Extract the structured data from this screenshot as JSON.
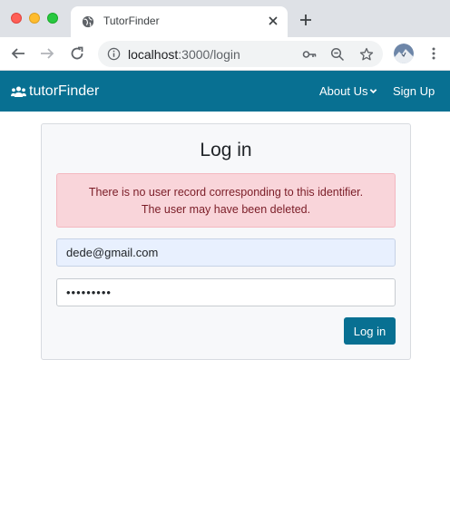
{
  "browser": {
    "tab_title": "TutorFinder",
    "url_host": "localhost",
    "url_rest": ":3000/login",
    "icons": [
      "globe-icon",
      "close-icon",
      "plus-icon",
      "back-icon",
      "forward-icon",
      "reload-icon",
      "info-icon",
      "key-icon",
      "zoom-icon",
      "star-icon",
      "more-icon"
    ]
  },
  "navbar": {
    "brand": "tutorFinder",
    "about": "About Us",
    "signup": "Sign Up",
    "color": "#087092"
  },
  "login": {
    "title": "Log in",
    "error_line1": "There is no user record corresponding to this identifier.",
    "error_line2": "The user may have been deleted.",
    "email_value": "dede@gmail.com",
    "password_value": "•••••••••",
    "button": "Log in"
  }
}
